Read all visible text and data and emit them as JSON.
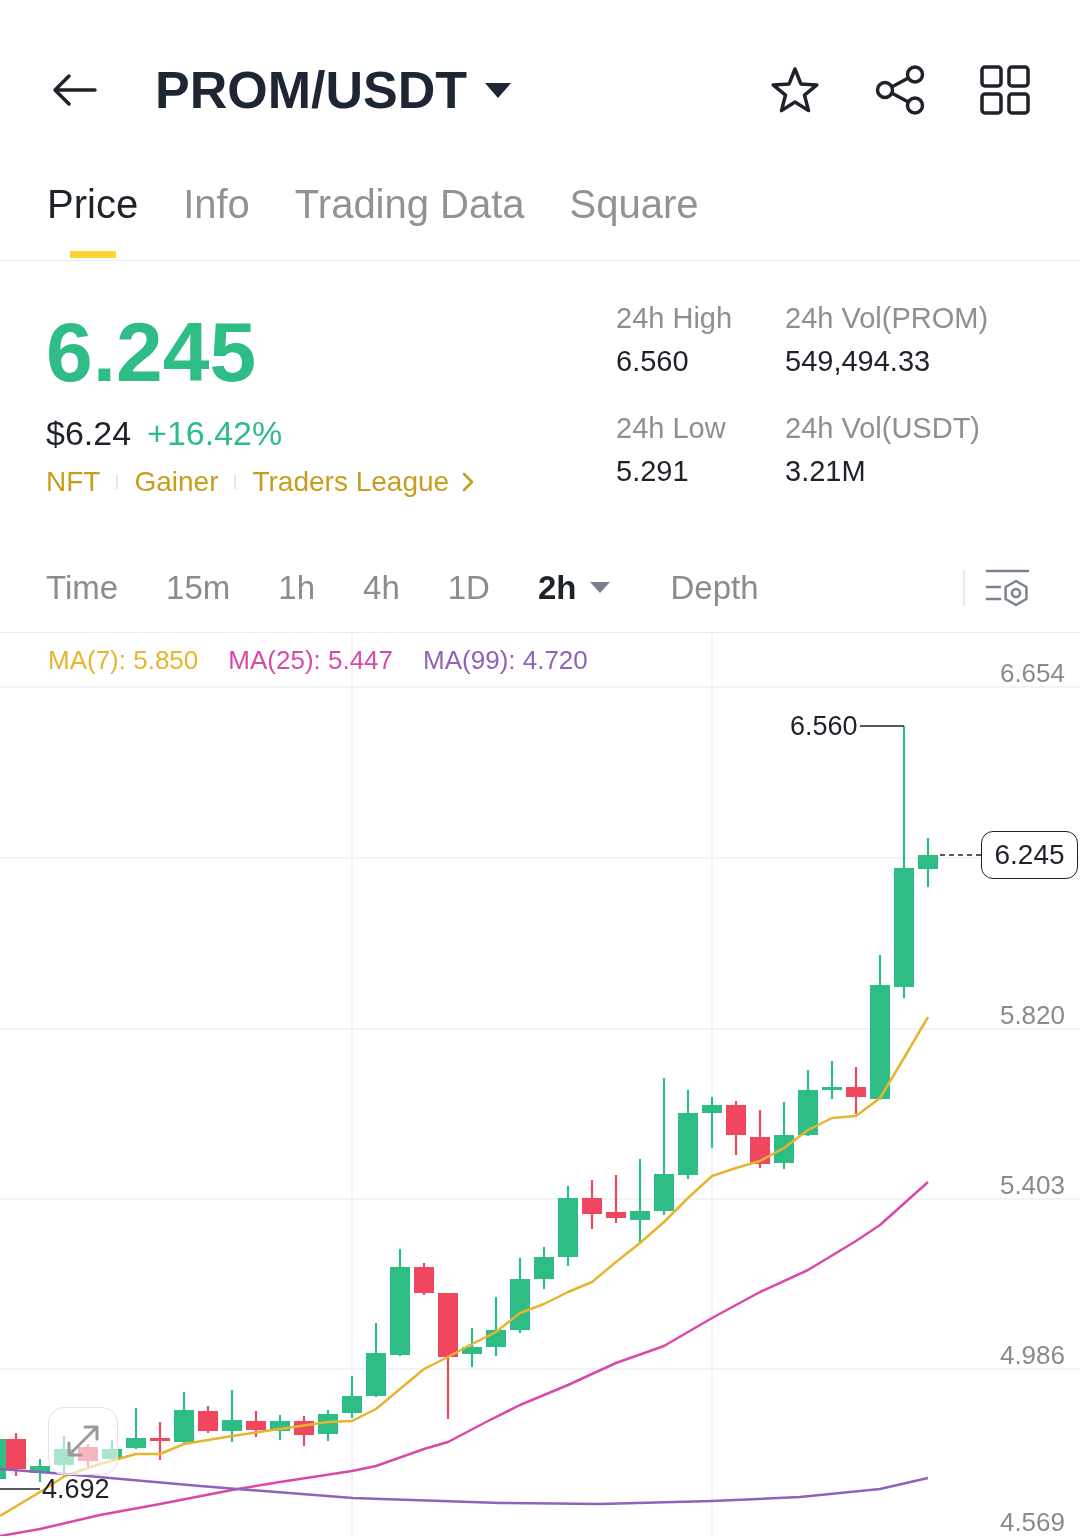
{
  "header": {
    "title": "PROM/USDT"
  },
  "tabs": [
    {
      "label": "Price",
      "selected": true
    },
    {
      "label": "Info",
      "selected": false
    },
    {
      "label": "Trading Data",
      "selected": false
    },
    {
      "label": "Square",
      "selected": false
    }
  ],
  "ticker": {
    "last_price": "6.245",
    "fiat_price": "$6.24",
    "change": "+16.42%",
    "tags": [
      {
        "label": "NFT",
        "kind": "tag"
      },
      {
        "label": "Gainer",
        "kind": "tag"
      },
      {
        "label": "Traders League",
        "kind": "link"
      }
    ]
  },
  "stats": [
    {
      "label": "24h High",
      "value": "6.560"
    },
    {
      "label": "24h Vol(PROM)",
      "value": "549,494.33"
    },
    {
      "label": "24h Low",
      "value": "5.291"
    },
    {
      "label": "24h Vol(USDT)",
      "value": "3.21M"
    }
  ],
  "intervals": [
    {
      "label": "Time",
      "selected": false,
      "kind": "option"
    },
    {
      "label": "15m",
      "selected": false,
      "kind": "option"
    },
    {
      "label": "1h",
      "selected": false,
      "kind": "option"
    },
    {
      "label": "4h",
      "selected": false,
      "kind": "option"
    },
    {
      "label": "1D",
      "selected": false,
      "kind": "option"
    },
    {
      "label": "2h",
      "selected": true,
      "kind": "dropdown"
    },
    {
      "label": "Depth",
      "selected": false,
      "kind": "option"
    }
  ],
  "chart": {
    "indicators": [
      {
        "label": "MA(7): 5.850",
        "color": "#e6b52f"
      },
      {
        "label": "MA(25): 5.447",
        "color": "#d94aa8"
      },
      {
        "label": "MA(99): 4.720",
        "color": "#8e63b9"
      }
    ],
    "price_axis": [
      "6.654",
      "5.820",
      "5.403",
      "4.986",
      "4.569"
    ],
    "high_label": "6.560",
    "low_label": "4.692",
    "last_price_tag": "6.245"
  }
}
